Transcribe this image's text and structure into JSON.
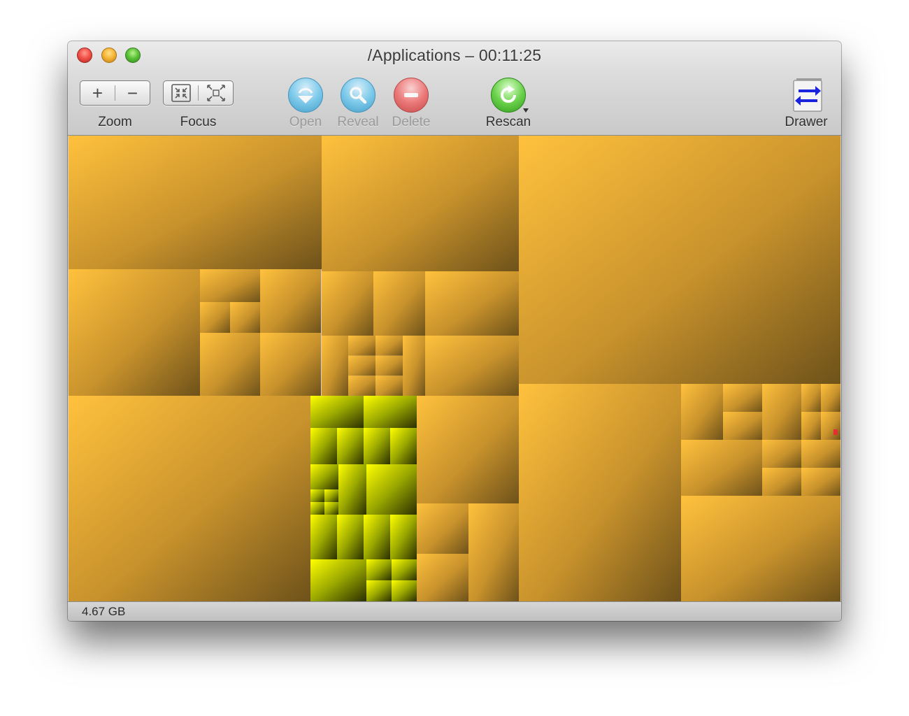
{
  "window": {
    "title": "/Applications – 00:11:25"
  },
  "toolbar": {
    "zoom_label": "Zoom",
    "focus_label": "Focus",
    "open_label": "Open",
    "reveal_label": "Reveal",
    "delete_label": "Delete",
    "rescan_label": "Rescan",
    "drawer_label": "Drawer",
    "zoom_in_glyph": "+",
    "zoom_out_glyph": "−",
    "disabled": [
      "open",
      "reveal",
      "delete"
    ]
  },
  "status": {
    "total_size": "4.67 GB"
  },
  "colors": {
    "block_fill_light": "#ffc13d",
    "block_fill_dark": "#6e521a",
    "selected_fill_light": "#ffff00",
    "selected_fill_dark": "#2a2f00",
    "accent_highlight": "#e03030"
  },
  "icons": {
    "zoom_in": "plus-icon",
    "zoom_out": "minus-icon",
    "focus_in": "focus-in-icon",
    "focus_out": "focus-out-icon",
    "open": "open-arrow-icon",
    "reveal": "magnifier-icon",
    "delete": "minus-circle-icon",
    "rescan": "refresh-icon",
    "drawer": "swap-arrows-icon"
  }
}
